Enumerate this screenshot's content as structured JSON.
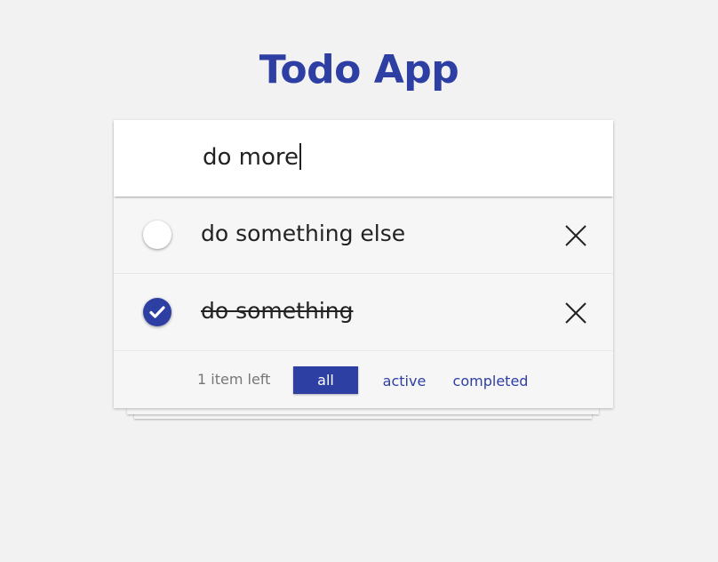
{
  "app": {
    "title": "Todo App"
  },
  "new_todo": {
    "value": "do more"
  },
  "todos": [
    {
      "label": "do something else",
      "completed": false
    },
    {
      "label": "do something",
      "completed": true
    }
  ],
  "footer": {
    "count_text": "1 item left",
    "filters": [
      {
        "label": "all",
        "selected": true
      },
      {
        "label": "active",
        "selected": false
      },
      {
        "label": "completed",
        "selected": false
      }
    ]
  },
  "colors": {
    "accent": "#2e3fa3",
    "background": "#f2f2f2",
    "card": "#f6f6f6",
    "input_background": "#ffffff",
    "muted_text": "#777777"
  },
  "icons": {
    "toggle_checked": "checkmark-icon",
    "destroy": "close-icon"
  }
}
